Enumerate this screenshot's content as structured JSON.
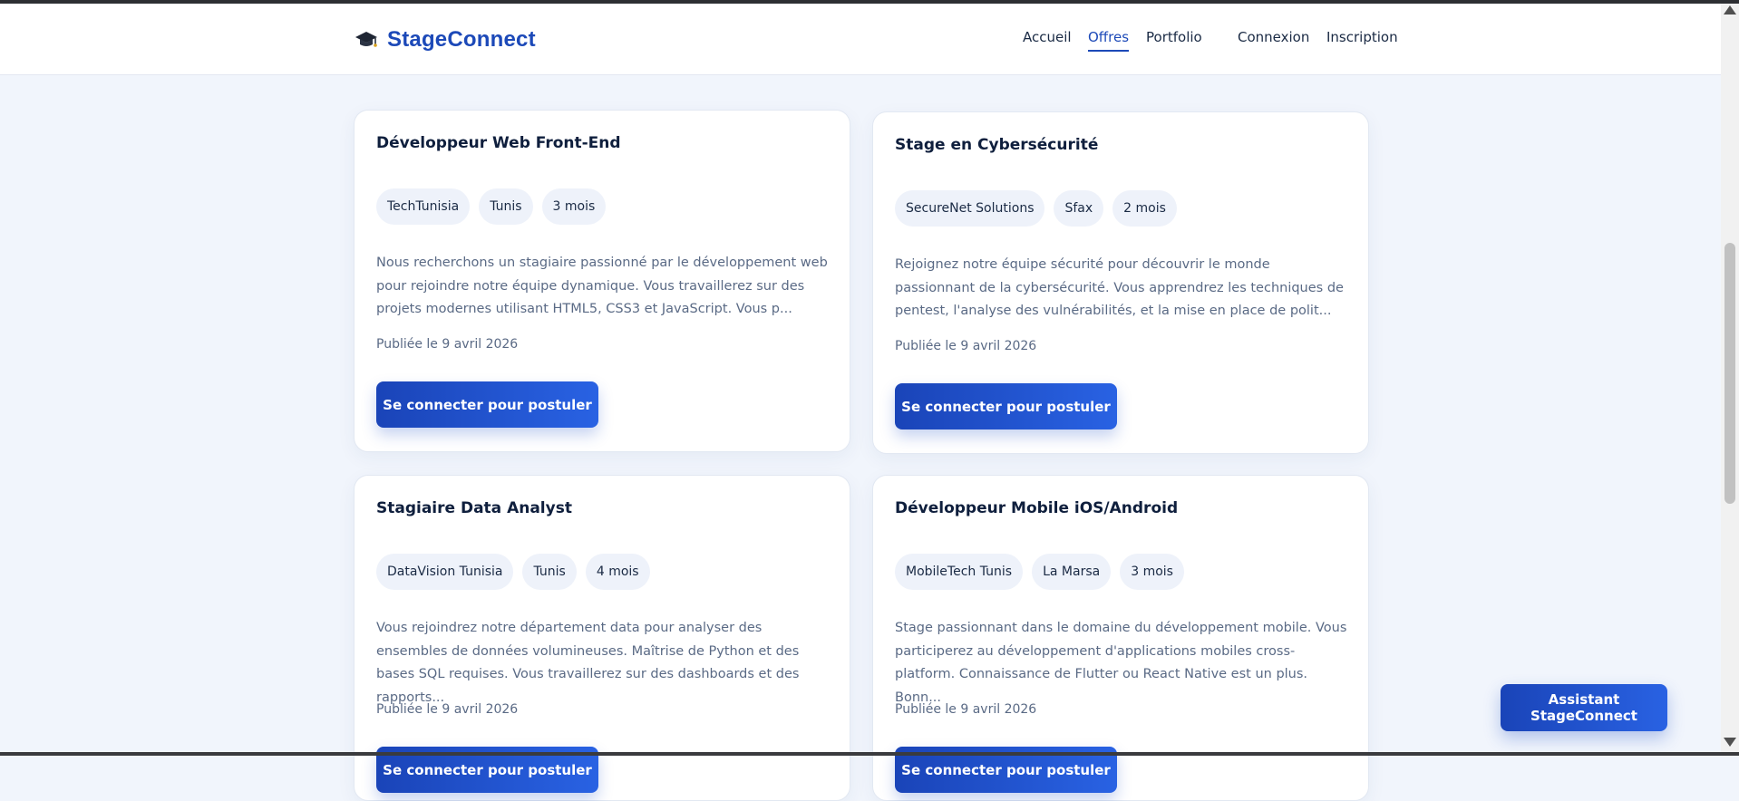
{
  "brand": {
    "icon": "graduation-cap-icon",
    "name": "StageConnect",
    "color": "#1c49b8"
  },
  "nav": {
    "items": [
      {
        "label": "Accueil"
      },
      {
        "label": "Offres",
        "active": true
      },
      {
        "label": "Portfolio"
      },
      {
        "label": "Connexion"
      },
      {
        "label": "Inscription"
      }
    ]
  },
  "offers": [
    {
      "title": "Développeur Web Front-End",
      "tags": [
        "TechTunisia",
        "Tunis",
        "3 mois"
      ],
      "description": "Nous recherchons un stagiaire passionné par le développement web pour rejoindre notre équipe dynamique. Vous travaillerez sur des projets modernes utilisant HTML5, CSS3 et JavaScript. Vous p...",
      "date": "Publiée le 9 avril 2026",
      "button": "Se connecter pour postuler"
    },
    {
      "title": "Stage en Cybersécurité",
      "tags": [
        "SecureNet Solutions",
        "Sfax",
        "2 mois"
      ],
      "description": "Rejoignez notre équipe sécurité pour découvrir le monde passionnant de la cybersécurité. Vous apprendrez les techniques de pentest, l'analyse des vulnérabilités, et la mise en place de polit...",
      "date": "Publiée le 9 avril 2026",
      "button": "Se connecter pour postuler"
    },
    {
      "title": "Stagiaire Data Analyst",
      "tags": [
        "DataVision Tunisia",
        "Tunis",
        "4 mois"
      ],
      "description": "Vous rejoindrez notre département data pour analyser des ensembles de données volumineuses. Maîtrise de Python et des bases SQL requises. Vous travaillerez sur des dashboards et des rapports...",
      "date": "Publiée le 9 avril 2026",
      "button": "Se connecter pour postuler"
    },
    {
      "title": "Développeur Mobile iOS/Android",
      "tags": [
        "MobileTech Tunis",
        "La Marsa",
        "3 mois"
      ],
      "description": "Stage passionnant dans le domaine du développement mobile. Vous participerez au développement d'applications mobiles cross-platform. Connaissance de Flutter ou React Native est un plus. Bonn...",
      "date": "Publiée le 9 avril 2026",
      "button": "Se connecter pour postuler"
    }
  ],
  "assistant": {
    "label": "Assistant StageConnect"
  },
  "colors": {
    "accent": "#1c49b8",
    "background": "#f1f5fc",
    "tag_bg": "#eef2fa"
  }
}
